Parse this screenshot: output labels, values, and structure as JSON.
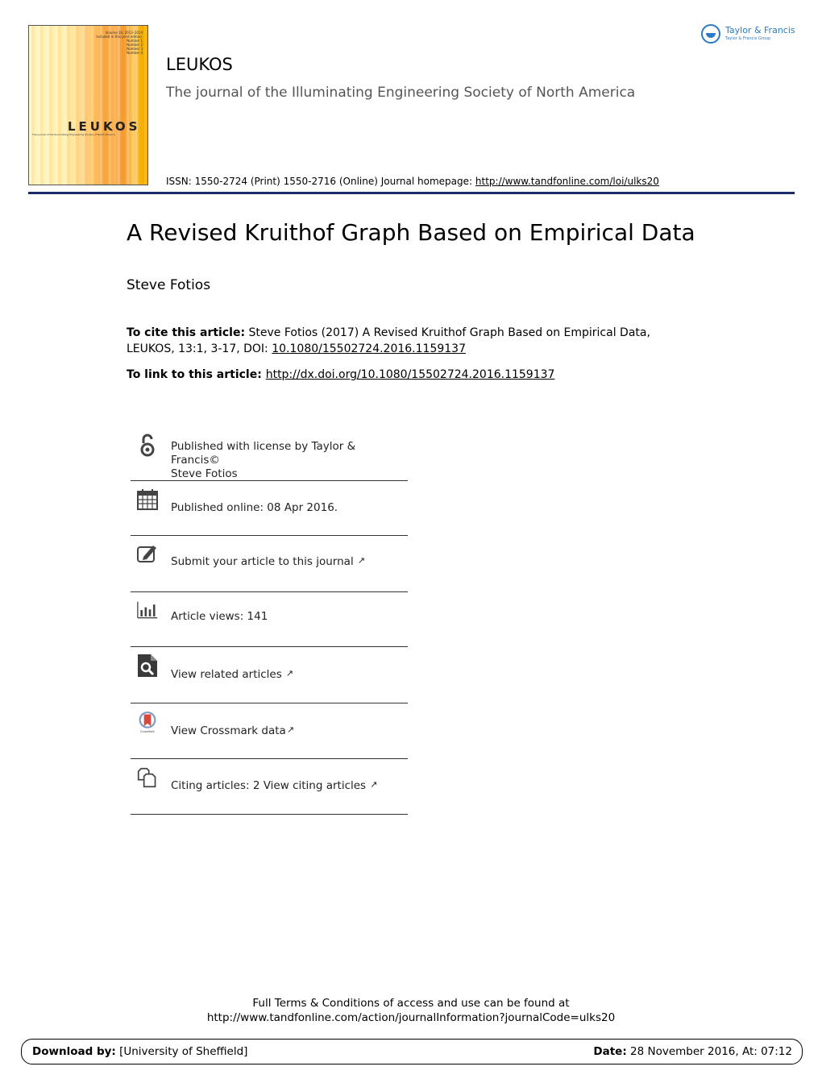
{
  "cover": {
    "volume_lines": [
      "Volume 10, 2013–2014",
      "Included in this print edition:",
      "Number 1",
      "Number 2",
      "Number 3",
      "Number 4"
    ],
    "name": "LEUKOS",
    "subtitle": "The journal of the Illuminating Engineering Society of North America"
  },
  "header": {
    "journal_title": "LEUKOS",
    "journal_subtitle": "The journal of the Illuminating Engineering Society of North America",
    "publisher_logo": {
      "name": "Taylor & Francis",
      "group": "Taylor & Francis Group"
    },
    "issn_text": "ISSN: 1550-2724 (Print) 1550-2716 (Online) Journal homepage: ",
    "homepage_url": "http://www.tandfonline.com/loi/ulks20",
    "rule_color": "#1b2a6b"
  },
  "article": {
    "title": "A Revised Kruithof Graph Based on Empirical Data",
    "author": "Steve Fotios",
    "cite_label": "To cite this article:",
    "cite_text": " Steve Fotios (2017) A Revised Kruithof Graph Based on Empirical Data, LEUKOS, 13:1, 3-17, DOI: ",
    "doi": "10.1080/15502724.2016.1159137",
    "link_label": "To link to this article: ",
    "link_url": "http://dx.doi.org/10.1080/15502724.2016.1159137"
  },
  "panel": {
    "items": [
      {
        "icon": "open-access-icon",
        "line1": "Published with license by Taylor & Francis©",
        "line2": "Steve Fotios"
      },
      {
        "icon": "calendar-icon",
        "line1": "Published online: 08 Apr 2016."
      },
      {
        "icon": "edit-icon",
        "line1": "Submit your article to this journal",
        "external": true
      },
      {
        "icon": "bar-chart-icon",
        "line1": "Article views: 141"
      },
      {
        "icon": "search-document-icon",
        "line1": "View related articles",
        "external": true
      },
      {
        "icon": "crossmark-icon",
        "line1": "View Crossmark data",
        "external": true
      },
      {
        "icon": "citing-articles-icon",
        "line1": "Citing articles: 2 View citing articles",
        "external": true
      }
    ],
    "external_glyph": "↗"
  },
  "footer": {
    "terms_line1": "Full Terms & Conditions of access and use can be found at",
    "terms_line2": "http://www.tandfonline.com/action/journalInformation?journalCode=ulks20",
    "download_label": "Download by:",
    "download_value": " [University of Sheffield]",
    "date_label": "Date:",
    "date_value": " 28 November 2016, At: 07:12"
  }
}
